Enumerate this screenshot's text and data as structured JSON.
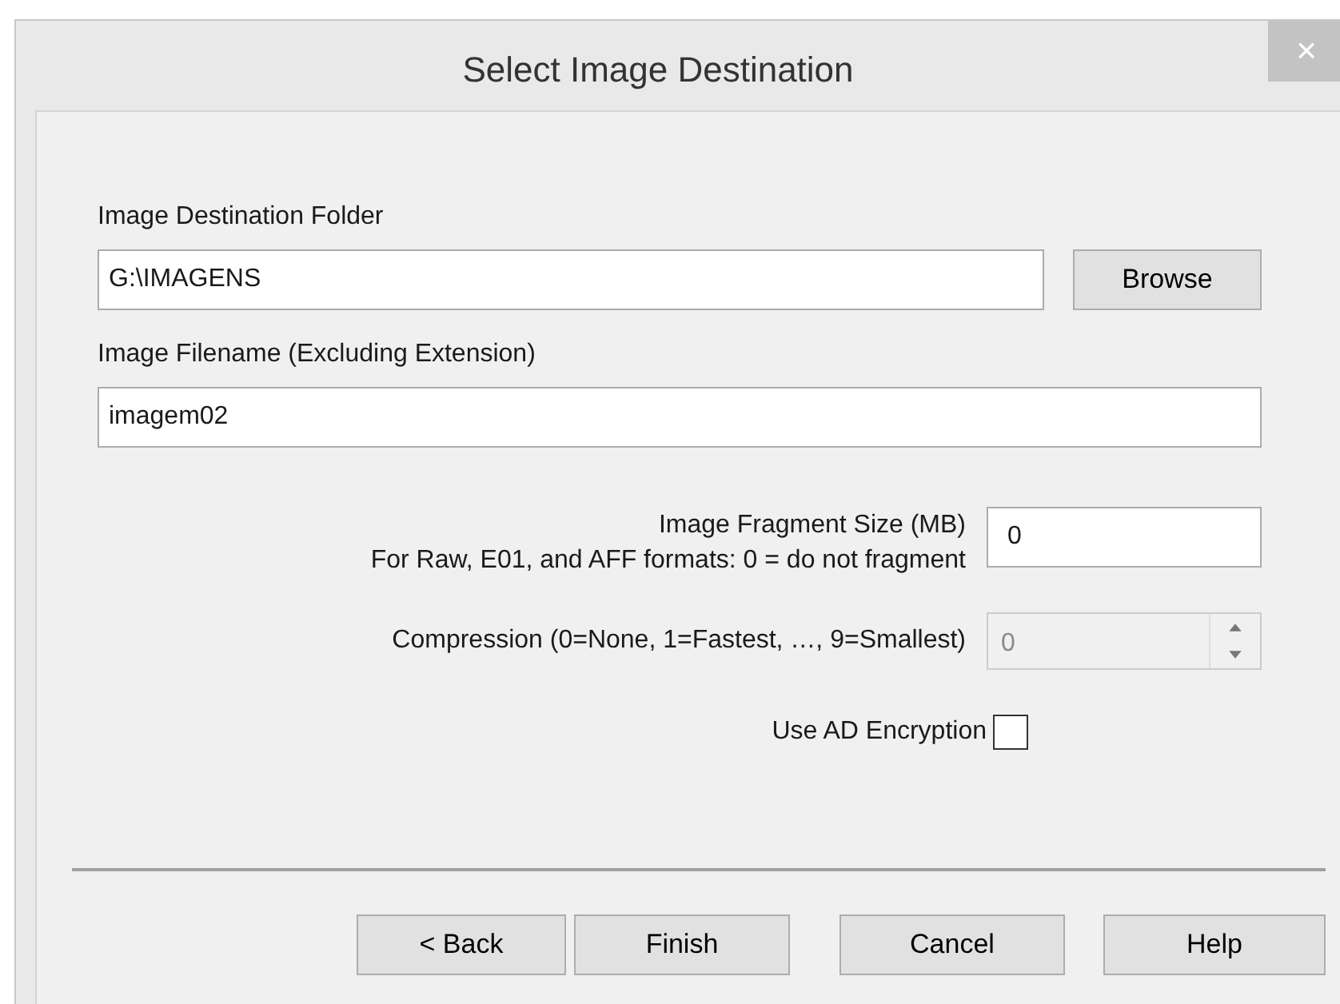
{
  "window": {
    "title": "Select Image Destination",
    "close": "×"
  },
  "destination": {
    "label": "Image Destination Folder",
    "value": "G:\\IMAGENS",
    "browse": "Browse"
  },
  "filename": {
    "label": "Image Filename (Excluding Extension)",
    "value": "imagem02"
  },
  "fragment": {
    "label": "Image Fragment Size (MB)",
    "hint": "For Raw, E01, and AFF formats: 0 = do not fragment",
    "value": "0"
  },
  "compression": {
    "label": "Compression (0=None, 1=Fastest, …, 9=Smallest)",
    "value": "0",
    "disabled": true
  },
  "encryption": {
    "label": "Use AD Encryption",
    "checked": false
  },
  "buttons": [
    "< Back",
    "Finish",
    "Cancel",
    "Help"
  ]
}
